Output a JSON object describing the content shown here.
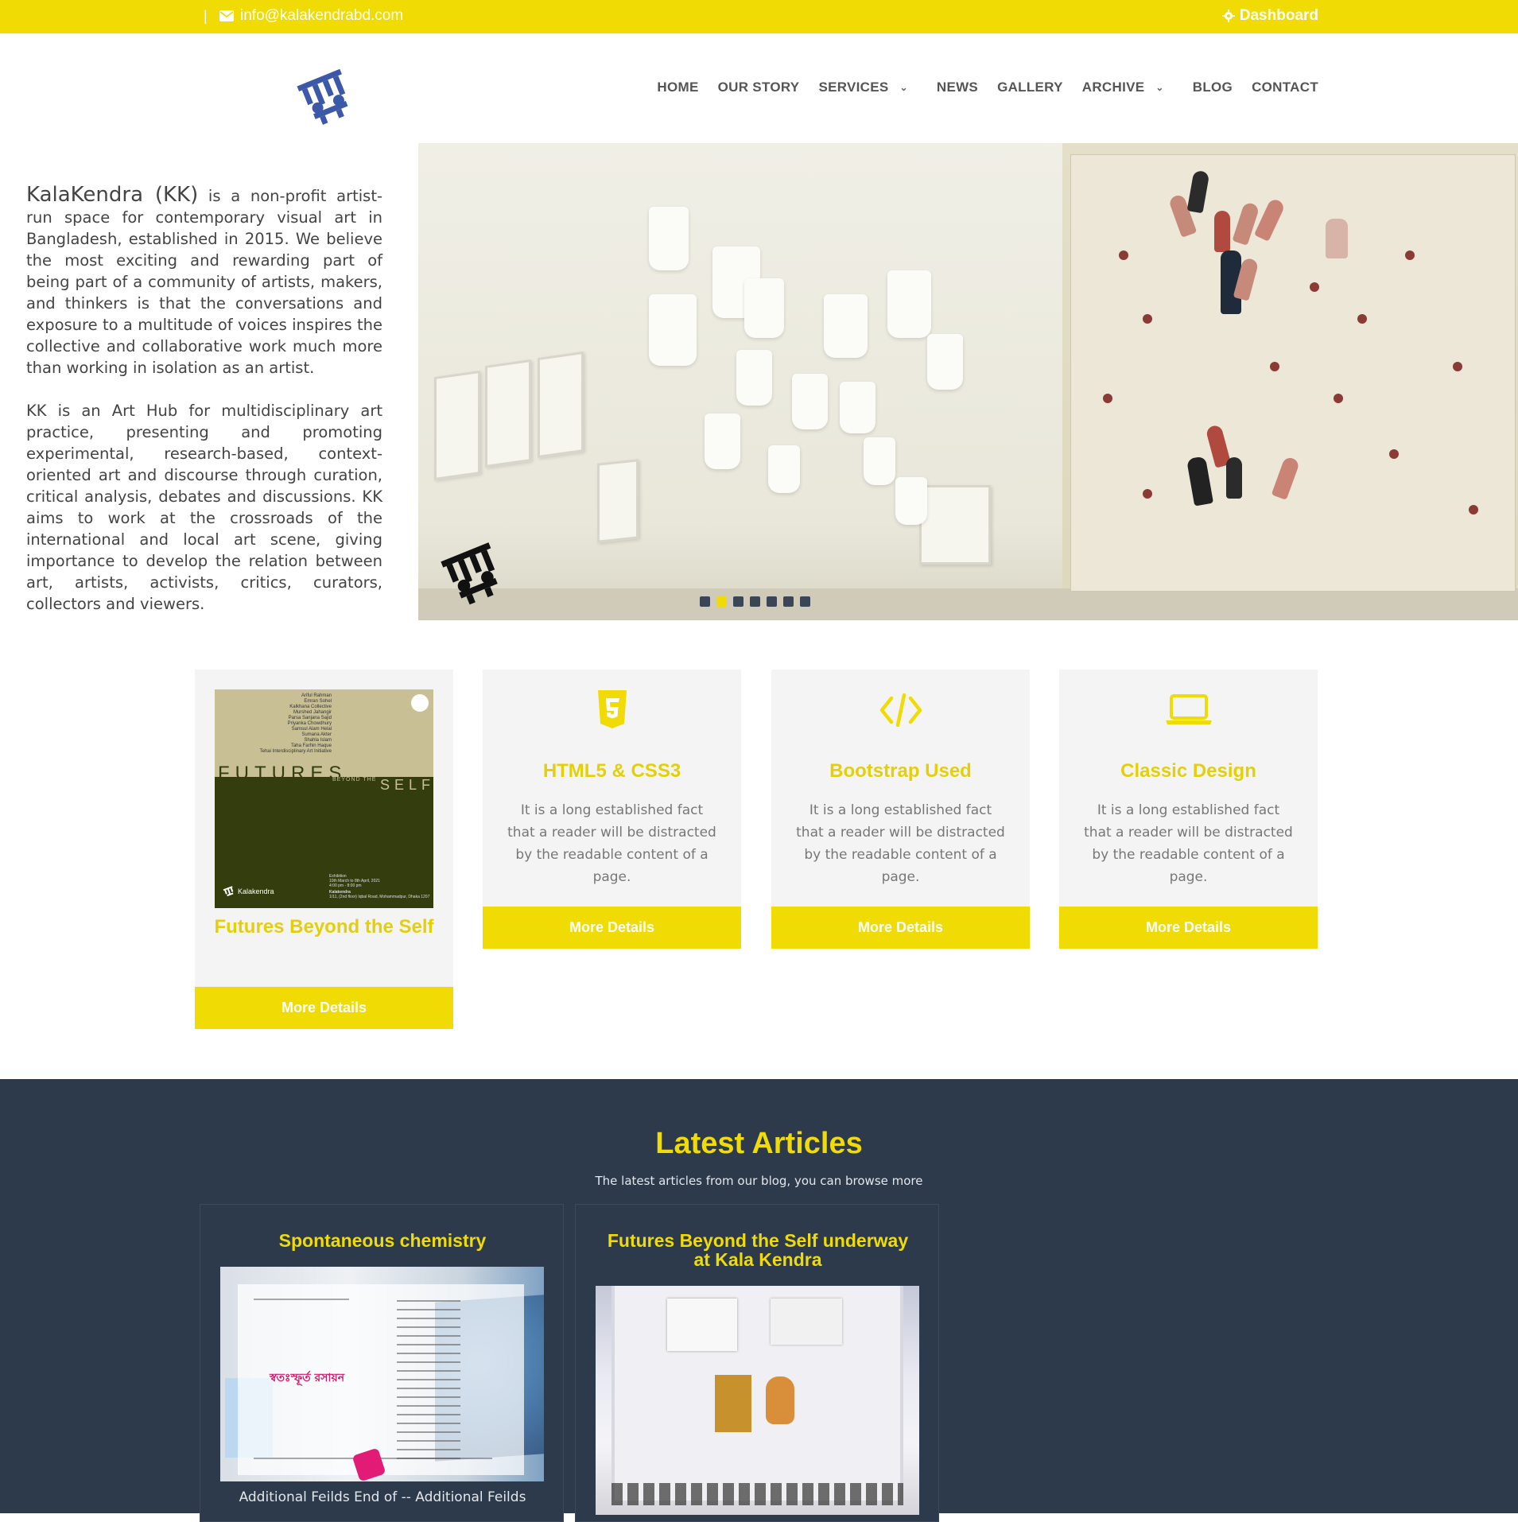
{
  "topbar": {
    "separator": "|",
    "email": "info@kalakendrabd.com",
    "dashboard_label": "Dashboard",
    "bg_color": "#f0db05"
  },
  "nav": {
    "items": [
      {
        "label": "HOME",
        "dropdown": false
      },
      {
        "label": "OUR STORY",
        "dropdown": false
      },
      {
        "label": "SERVICES",
        "dropdown": true
      },
      {
        "label": "NEWS",
        "dropdown": false
      },
      {
        "label": "GALLERY",
        "dropdown": false
      },
      {
        "label": "ARCHIVE",
        "dropdown": true
      },
      {
        "label": "BLOG",
        "dropdown": false
      },
      {
        "label": "CONTACT",
        "dropdown": false
      }
    ]
  },
  "intro": {
    "brand": "KalaKendra (KK)",
    "p1_rest": " is a non-profit artist-run space for contemporary visual art in Bangladesh, established in 2015. We believe the most exciting and rewarding part of being part of a community of artists, makers, and thinkers is that the conversations and exposure to a multitude of voices inspires the collective and collaborative work much more than working in isolation as an artist.",
    "p2": "KK is an Art Hub for multidisciplinary art practice, presenting and promoting experimental, research-based, context-oriented art and discourse through curation, critical analysis, debates and discussions. KK aims to work at the crossroads of the international and local art scene, giving importance to develop the relation between art, artists, activists, critics, curators, collectors and viewers."
  },
  "slider": {
    "slide_count": 7,
    "active_index": 1
  },
  "features": [
    {
      "title": "Futures Beyond the Self",
      "button": "More Details",
      "poster": {
        "names": [
          "Ariful Rahman",
          "Emran Sohel",
          "Kalkhana Collective",
          "Murshed Jahangir",
          "Parsa Sanjana Sajid",
          "Priyanka Chowdhury",
          "Samsul Alam Helal",
          "Sumana Akter",
          "Shahla Islam",
          "Taha Farhin Haque",
          "Tehai Interdisciplinary Art Initiative"
        ],
        "word1": "FUTURES",
        "word2": "BEYOND THE",
        "word3": "SELF",
        "brand": "Kalakendra",
        "info": [
          "Exhibition",
          "10th March to 8th April, 2021",
          "4:00 pm - 8:00 pm",
          "Kalakendra",
          "1/11, (2nd floor) Iqbal Road, Mohammadpur, Dhaka 1207"
        ]
      }
    },
    {
      "icon": "html5-icon",
      "title": "HTML5 & CSS3",
      "desc": "It is a long established fact that a reader will be distracted by the readable content of a page.",
      "button": "More Details"
    },
    {
      "icon": "code-icon",
      "title": "Bootstrap Used",
      "desc": "It is a long established fact that a reader will be distracted by the readable content of a page.",
      "button": "More Details"
    },
    {
      "icon": "laptop-icon",
      "title": "Classic Design",
      "desc": "It is a long established fact that a reader will be distracted by the readable content of a page.",
      "button": "More Details"
    }
  ],
  "articles": {
    "heading": "Latest Articles",
    "subheading": "The latest articles from our blog, you can browse more",
    "items": [
      {
        "title": "Spontaneous chemistry",
        "caption": "Additional Feilds End of -- Additional Feilds",
        "poster_title": "স্বতঃস্ফূর্ত রসায়ন"
      },
      {
        "title": "Futures Beyond the Self underway at Kala Kendra"
      }
    ]
  },
  "colors": {
    "accent": "#f0db05",
    "dark": "#2c3a4b",
    "card_bg": "#f4f4f4"
  }
}
